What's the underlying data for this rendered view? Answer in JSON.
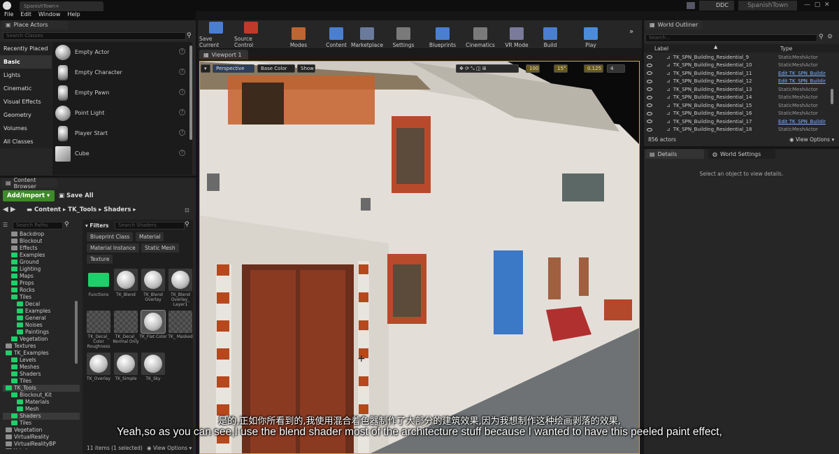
{
  "app": {
    "project": "SpanishTown+",
    "project_label": "SpanishTown",
    "ddc": "DDC"
  },
  "menu": [
    "File",
    "Edit",
    "Window",
    "Help"
  ],
  "place_actors": {
    "tab": "Place Actors",
    "search_placeholder": "Search Classes",
    "categories": [
      "Recently Placed",
      "Basic",
      "Lights",
      "Cinematic",
      "Visual Effects",
      "Geometry",
      "Volumes",
      "All Classes"
    ],
    "selected_category": "Basic",
    "actors": [
      "Empty Actor",
      "Empty Character",
      "Empty Pawn",
      "Point Light",
      "Player Start",
      "Cube"
    ]
  },
  "toolbar": [
    "Save Current",
    "Source Control",
    "Modes",
    "Content",
    "Marketplace",
    "Settings",
    "Blueprints",
    "Cinematics",
    "VR Mode",
    "Build",
    "Play"
  ],
  "viewport": {
    "tab": "Viewport 1",
    "perspective": "Perspective",
    "view_mode": "Base Color",
    "show": "Show",
    "snap_grid": "100",
    "snap_rot": "15°",
    "snap_scale": "0.125",
    "cam_speed": "4"
  },
  "content_browser": {
    "tab": "Content Browser",
    "add_import": "Add/Import",
    "save_all": "Save All",
    "path": [
      "Content",
      "TK_Tools",
      "Shaders"
    ],
    "search_paths": "Search Paths",
    "filters": "Filters",
    "search_shaders": "Search Shaders",
    "chips": [
      "Blueprint Class",
      "Material",
      "Material Instance",
      "Static Mesh",
      "Texture"
    ],
    "folders": [
      {
        "name": "Backdrop",
        "indent": 1,
        "green": false
      },
      {
        "name": "Blockout",
        "indent": 1,
        "green": false
      },
      {
        "name": "Effects",
        "indent": 1,
        "green": false
      },
      {
        "name": "Examples",
        "indent": 1,
        "green": true
      },
      {
        "name": "Ground",
        "indent": 1,
        "green": true
      },
      {
        "name": "Lighting",
        "indent": 1,
        "green": true
      },
      {
        "name": "Maps",
        "indent": 1,
        "green": true
      },
      {
        "name": "Props",
        "indent": 1,
        "green": true
      },
      {
        "name": "Rocks",
        "indent": 1,
        "green": true
      },
      {
        "name": "Tiles",
        "indent": 1,
        "green": true
      },
      {
        "name": "Decal",
        "indent": 2,
        "green": true
      },
      {
        "name": "Examples",
        "indent": 2,
        "green": true
      },
      {
        "name": "General",
        "indent": 2,
        "green": true
      },
      {
        "name": "Noises",
        "indent": 2,
        "green": true
      },
      {
        "name": "Paintings",
        "indent": 2,
        "green": true
      },
      {
        "name": "Vegetation",
        "indent": 1,
        "green": true
      },
      {
        "name": "Textures",
        "indent": 0,
        "green": false
      },
      {
        "name": "TK_Examples",
        "indent": 0,
        "green": true
      },
      {
        "name": "Levels",
        "indent": 1,
        "green": true
      },
      {
        "name": "Meshes",
        "indent": 1,
        "green": true
      },
      {
        "name": "Shaders",
        "indent": 1,
        "green": true
      },
      {
        "name": "Tiles",
        "indent": 1,
        "green": true
      },
      {
        "name": "TK_Tools",
        "indent": 0,
        "green": true
      },
      {
        "name": "Blockout_Kit",
        "indent": 1,
        "green": true
      },
      {
        "name": "Materials",
        "indent": 2,
        "green": true
      },
      {
        "name": "Mesh",
        "indent": 2,
        "green": true
      },
      {
        "name": "Shaders",
        "indent": 1,
        "green": true
      },
      {
        "name": "Tiles",
        "indent": 1,
        "green": true
      },
      {
        "name": "Vegetation",
        "indent": 0,
        "green": false
      },
      {
        "name": "VirtualReality",
        "indent": 0,
        "green": false
      },
      {
        "name": "VirtualRealityBP",
        "indent": 0,
        "green": false
      },
      {
        "name": "Yakohama",
        "indent": 0,
        "green": false
      }
    ],
    "assets": [
      {
        "label": "Functions",
        "kind": "folder"
      },
      {
        "label": "TK_Blend",
        "kind": "ball"
      },
      {
        "label": "TK_Blend Overlay",
        "kind": "ball"
      },
      {
        "label": "TK_Blend Overlay_ Layer1",
        "kind": "ball"
      },
      {
        "label": "TK_Decal_ Color Roughness",
        "kind": "check"
      },
      {
        "label": "TK_Decal_ Normal Only",
        "kind": "check"
      },
      {
        "label": "TK_Flat Color",
        "kind": "ball"
      },
      {
        "label": "TK_ Masked",
        "kind": "check"
      },
      {
        "label": "TK_Overlay",
        "kind": "ball"
      },
      {
        "label": "TK_Simple",
        "kind": "ball"
      },
      {
        "label": "TK_Sky",
        "kind": "ball"
      }
    ],
    "status": "11 items (1 selected)",
    "view_options": "View Options"
  },
  "outliner": {
    "tab": "World Outliner",
    "search_placeholder": "Search...",
    "col_label": "Label",
    "col_type": "Type",
    "rows": [
      {
        "label": "TK_SPN_Building_Residential_9",
        "type": "StaticMeshActor",
        "link": false
      },
      {
        "label": "TK_SPN_Building_Residential_10",
        "type": "StaticMeshActor",
        "link": false
      },
      {
        "label": "TK_SPN_Building_Residential_11",
        "type": "Edit TK_SPN_Buildir",
        "link": true
      },
      {
        "label": "TK_SPN_Building_Residential_12",
        "type": "Edit TK_SPN_Buildir",
        "link": true
      },
      {
        "label": "TK_SPN_Building_Residential_13",
        "type": "StaticMeshActor",
        "link": false
      },
      {
        "label": "TK_SPN_Building_Residential_14",
        "type": "StaticMeshActor",
        "link": false
      },
      {
        "label": "TK_SPN_Building_Residential_15",
        "type": "StaticMeshActor",
        "link": false
      },
      {
        "label": "TK_SPN_Building_Residential_16",
        "type": "StaticMeshActor",
        "link": false
      },
      {
        "label": "TK_SPN_Building_Residential_17",
        "type": "Edit TK_SPN_Buildir",
        "link": true
      },
      {
        "label": "TK_SPN_Building_Residential_18",
        "type": "StaticMeshActor",
        "link": false
      }
    ],
    "count": "856 actors",
    "view_options": "View Options"
  },
  "details": {
    "tab": "Details",
    "tab2": "World Settings",
    "empty": "Select an object to view details."
  },
  "subtitles": {
    "zh": "是的,正如你所看到的,我使用混合着色器制作了大部分的建筑效果,因为我想制作这种绘画剥落的效果,",
    "en": "Yeah,so as you can see,I use the blend shader most of the architecture stuff because I wanted to have this peeled paint effect,"
  },
  "colors": {
    "accent": "#1fcf6a",
    "link": "#7fb4ff",
    "play": "#4a8cd8"
  }
}
